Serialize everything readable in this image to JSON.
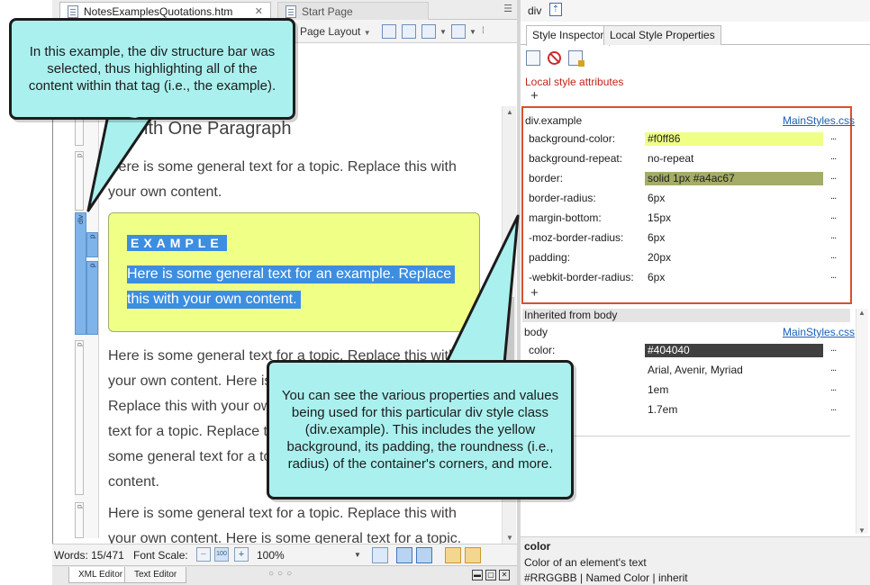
{
  "editor": {
    "tabs": [
      {
        "label": "NotesExamplesQuotations.htm",
        "close": "✕"
      },
      {
        "label": "Start Page",
        "close": ""
      }
    ],
    "toolbar": {
      "page_layout": "Page Layout"
    },
    "structure_bars": {
      "div": "div",
      "p": "p",
      "h": "h"
    },
    "content": {
      "heading": "le With One Paragraph",
      "para1": "Here is some general text for a topic. Replace this with your own content.",
      "example_label": "EXAMPLE",
      "example_line1": "Here is some general text for an example. Replace",
      "example_line2": "this with your own content.",
      "para2": "Here is some general text for a topic. Replace this with your own content. Here is some general text for a topic. Replace this with your own content. Here is some general text for a topic. Replace this with your own content. Here is some general text for a topic. Replace this with your own content.",
      "para3": "Here is some general text for a topic. Replace this with your own content. Here is some general text for a topic."
    },
    "status": {
      "words": "Words: 15/471",
      "font_scale": "Font Scale:",
      "minus": "−",
      "reset": "100",
      "plus": "+",
      "zoom": "100%"
    },
    "bottom_tabs": [
      "XML Editor",
      "Text Editor"
    ],
    "bottom_dots": "○○○"
  },
  "inspector": {
    "element": "div",
    "tabs": [
      "Style Inspector",
      "Local Style Properties"
    ],
    "local_title": "Local style attributes",
    "add_symbol": "+",
    "selector": "div.example",
    "stylesheet": "MainStyles.css",
    "properties": [
      {
        "name": "background-color:",
        "value": "#f0ff86",
        "swatch": "#f0ff86"
      },
      {
        "name": "background-repeat:",
        "value": "no-repeat",
        "swatch": ""
      },
      {
        "name": "border:",
        "value": "solid 1px #a4ac67",
        "swatch": "#a4ac67"
      },
      {
        "name": "border-radius:",
        "value": "6px",
        "swatch": ""
      },
      {
        "name": "margin-bottom:",
        "value": "15px",
        "swatch": ""
      },
      {
        "name": "-moz-border-radius:",
        "value": "6px",
        "swatch": ""
      },
      {
        "name": "padding:",
        "value": "20px",
        "swatch": ""
      },
      {
        "name": "-webkit-border-radius:",
        "value": "6px",
        "swatch": ""
      }
    ],
    "more": "...",
    "inherited_title": "Inherited from body",
    "inherited_selector": "body",
    "inherited_properties": [
      {
        "name": "color:",
        "value": "#404040",
        "swatch": "#404040"
      },
      {
        "name": "y:",
        "value": "Arial, Avenir, Myriad",
        "swatch": ""
      },
      {
        "name": "",
        "value": "1em",
        "swatch": ""
      },
      {
        "name": "t:",
        "value": "1.7em",
        "swatch": ""
      }
    ],
    "help": {
      "title": "color",
      "description": "Color of an element's text",
      "values": "#RRGGBB | Named Color | inherit"
    }
  },
  "callouts": {
    "top": "In this example, the div structure bar was selected, thus highlighting all of the content within that tag (i.e., the example).",
    "bottom": "You can see the various properties and values being used for this particular div style class (div.example). This includes the yellow background, its padding, the roundness (i.e., radius) of the container's corners, and more."
  },
  "colors": {
    "callout_fill": "#aaf0ee",
    "selection": "#3d8ee0",
    "highlight_box": "#d8512b",
    "link": "#1a5fb4"
  }
}
